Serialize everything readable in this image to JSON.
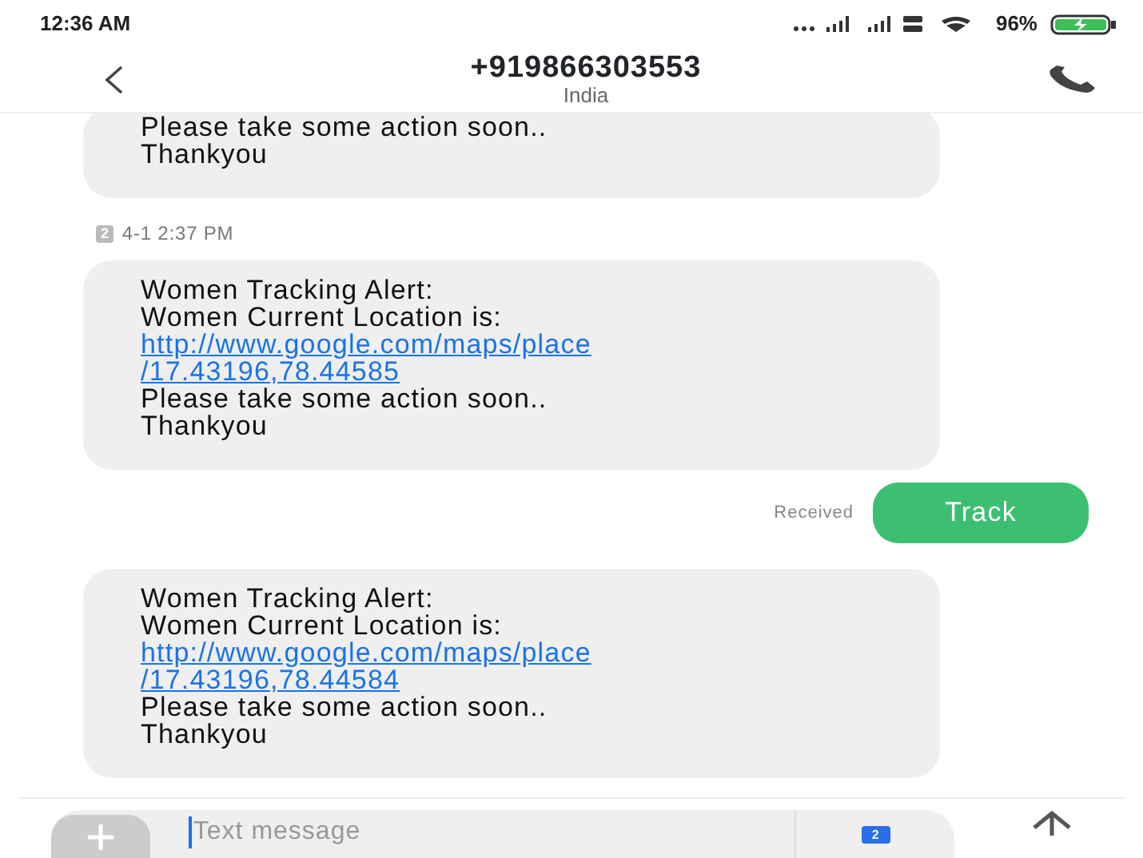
{
  "status_bar": {
    "time": "12:36 AM",
    "battery": "96%"
  },
  "header": {
    "title": "+919866303553",
    "subtitle": "India"
  },
  "messages": [
    {
      "kind": "incoming",
      "lines": [
        {
          "text": "Please take some action soon..",
          "link": false
        },
        {
          "text": "Thankyou",
          "link": false
        }
      ]
    },
    {
      "kind": "timestamp",
      "sim": "2",
      "text": "4-1 2:37 PM"
    },
    {
      "kind": "incoming",
      "lines": [
        {
          "text": "Women Tracking Alert:",
          "link": false
        },
        {
          "text": "Women Current Location is:",
          "link": false
        },
        {
          "text": "http://www.google.com/maps/place",
          "link": true
        },
        {
          "text": "/17.43196,78.44585",
          "link": true
        },
        {
          "text": "Please take some action soon..",
          "link": false
        },
        {
          "text": "Thankyou",
          "link": false
        }
      ]
    },
    {
      "kind": "outgoing",
      "status": "Received",
      "text": "Track"
    },
    {
      "kind": "incoming",
      "lines": [
        {
          "text": "Women Tracking Alert:",
          "link": false
        },
        {
          "text": "Women Current Location is:",
          "link": false
        },
        {
          "text": "http://www.google.com/maps/place",
          "link": true
        },
        {
          "text": "/17.43196,78.44584",
          "link": true
        },
        {
          "text": "Please take some action soon..",
          "link": false
        },
        {
          "text": "Thankyou",
          "link": false
        }
      ]
    }
  ],
  "composer": {
    "placeholder": "Text message",
    "sim": "2"
  }
}
